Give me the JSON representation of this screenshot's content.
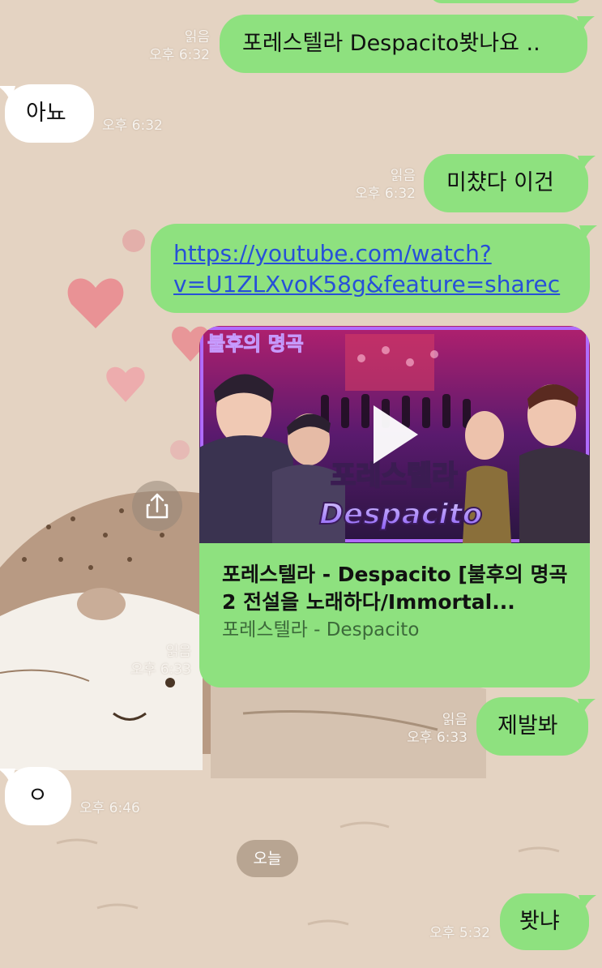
{
  "messages": [
    {
      "id": "m1",
      "text": "포레스텔라 Despacito봣나요 ..",
      "read": "읽음",
      "time": "오후 6:32"
    },
    {
      "id": "m2",
      "text": "아뇨",
      "time": "오후 6:32"
    },
    {
      "id": "m3",
      "text": "미챴다 이건",
      "read": "읽음",
      "time": "오후 6:32"
    },
    {
      "id": "m4",
      "link_line1": "https://youtube.com/watch?",
      "link_line2": "v=U1ZLXvoK58g&feature=sharec"
    },
    {
      "id": "m5",
      "preview": {
        "thumb_badge": "불후의 명곡",
        "thumb_title": "포레스텔라",
        "thumb_subtitle": "Despacito",
        "title": "포레스텔라 - Despacito [불후의 명곡2 전설을 노래하다/Immortal...",
        "subtitle": "포레스텔라 - Despacito"
      },
      "read": "읽음",
      "time": "오후 6:33"
    },
    {
      "id": "m6",
      "text": "제발봐",
      "read": "읽음",
      "time": "오후 6:33"
    },
    {
      "id": "m7",
      "text": "ㅇ",
      "time": "오후 6:46"
    },
    {
      "id": "m8",
      "text": "봣냐",
      "time": "오후 5:32"
    }
  ],
  "date_divider": "오늘",
  "icons": {
    "share": "share-icon",
    "play": "play-icon"
  },
  "colors": {
    "outgoing": "#8ee17f",
    "incoming": "#ffffff",
    "wallpaper": "#e4d3c2",
    "link": "#2750d8"
  }
}
